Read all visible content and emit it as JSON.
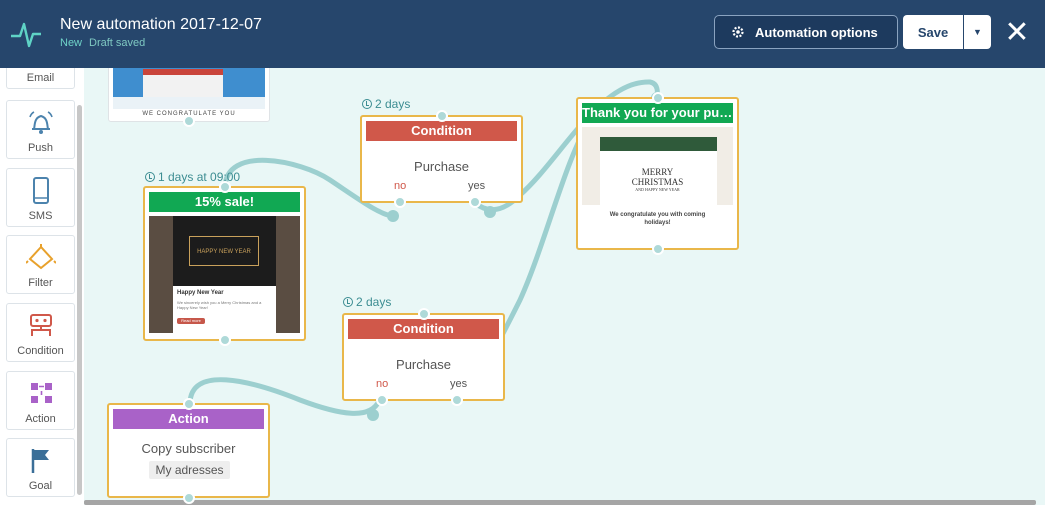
{
  "header": {
    "title": "New automation 2017-12-07",
    "status": "New",
    "draft": "Draft saved",
    "options_label": "Automation options",
    "save_label": "Save"
  },
  "sidebar": {
    "items": [
      {
        "label": "Email",
        "icon": "envelope-icon"
      },
      {
        "label": "Push",
        "icon": "bell-icon"
      },
      {
        "label": "SMS",
        "icon": "phone-icon"
      },
      {
        "label": "Filter",
        "icon": "filter-icon"
      },
      {
        "label": "Condition",
        "icon": "condition-icon"
      },
      {
        "label": "Action",
        "icon": "action-icon"
      },
      {
        "label": "Goal",
        "icon": "flag-icon"
      }
    ]
  },
  "canvas": {
    "top_email": {
      "caption": "WE CONGRATULATE YOU"
    },
    "sale_node": {
      "delay": "1 days at 09:00",
      "title": "15% sale!",
      "banner": "HAPPY NEW YEAR",
      "body_title": "Happy New Year",
      "body_text": "We sincerely wish you a Merry Christmas and a Happy New Year!",
      "button": "Read more"
    },
    "cond1": {
      "delay": "2 days",
      "title": "Condition",
      "text": "Purchase",
      "no": "no",
      "yes": "yes"
    },
    "cond2": {
      "delay": "2 days",
      "title": "Condition",
      "text": "Purchase",
      "no": "no",
      "yes": "yes"
    },
    "thank_node": {
      "title": "Thank you for your purchase",
      "line1": "MERRY",
      "line2": "CHRISTMAS",
      "line3": "AND HAPPY NEW YEAR",
      "caption": "We congratulate you with coming holidays!"
    },
    "action_node": {
      "title": "Action",
      "text": "Copy subscriber",
      "tag": "My adresses"
    }
  },
  "colors": {
    "header_bg": "#26466c",
    "canvas_bg": "#e9f7f6",
    "node_border": "#e9b74a",
    "condition": "#d0584a",
    "email_header": "#11a853",
    "action": "#a962c8",
    "wire": "#9ccfcf"
  }
}
